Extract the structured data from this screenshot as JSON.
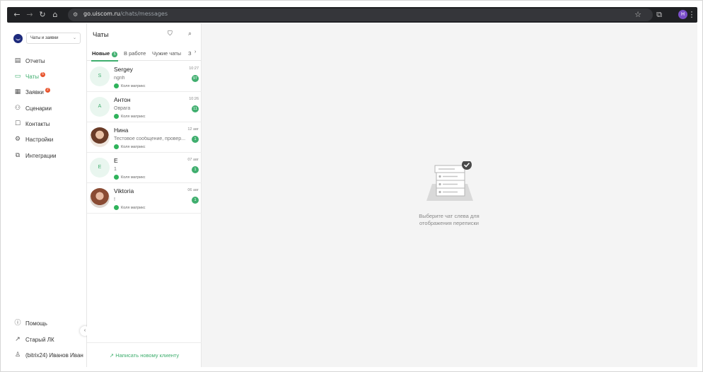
{
  "browser": {
    "url_host": "go.uiscom.ru",
    "url_path": "/chats/messages",
    "profile_initial": "Н"
  },
  "sidebar": {
    "workspace": "Чаты и заявки",
    "items": [
      {
        "label": "Отчеты",
        "icon": "reports-icon",
        "active": false
      },
      {
        "label": "Чаты",
        "icon": "chats-icon",
        "active": true,
        "badge": "5"
      },
      {
        "label": "Заявки",
        "icon": "requests-icon",
        "active": false,
        "badge": "2"
      },
      {
        "label": "Сценарии",
        "icon": "scenarios-icon",
        "active": false
      },
      {
        "label": "Контакты",
        "icon": "contacts-icon",
        "active": false
      },
      {
        "label": "Настройки",
        "icon": "settings-icon",
        "active": false
      },
      {
        "label": "Интеграции",
        "icon": "integrations-icon",
        "active": false
      }
    ],
    "bottom": [
      {
        "label": "Помощь",
        "icon": "help-icon"
      },
      {
        "label": "Старый ЛК",
        "icon": "external-link-icon"
      },
      {
        "label": "(bitrix24) Иванов Иван",
        "icon": "user-icon"
      }
    ]
  },
  "chats": {
    "title": "Чаты",
    "tabs": [
      {
        "label": "Новые",
        "count": "5",
        "active": true
      },
      {
        "label": "В работе",
        "active": false
      },
      {
        "label": "Чужие чаты",
        "active": false
      },
      {
        "label": "З",
        "active": false
      }
    ],
    "list": [
      {
        "name": "Sergey",
        "initial": "S",
        "preview": "ngnh",
        "source": "Коля матрикс",
        "time": "10:27",
        "count": "97",
        "photo": false
      },
      {
        "name": "Антон",
        "initial": "А",
        "preview": "Оврага",
        "source": "Коля матрикс",
        "time": "10:26",
        "count": "11",
        "photo": false
      },
      {
        "name": "Нина",
        "initial": "",
        "preview": "Тестовое сообщение, провер...",
        "source": "Коля матрикс",
        "time": "12 авг",
        "count": "1",
        "photo": true
      },
      {
        "name": "E",
        "initial": "E",
        "preview": "1",
        "source": "Коля матрикс",
        "time": "07 авг",
        "count": "1",
        "photo": false
      },
      {
        "name": "Viktoria",
        "initial": "",
        "preview": "!",
        "source": "Коля матрикс",
        "time": "06 авг",
        "count": "1",
        "photo": true
      }
    ],
    "write_new": "Написать новому клиенту"
  },
  "main": {
    "empty_line1": "Выберите чат слева для",
    "empty_line2": "отображения переписки"
  },
  "colors": {
    "accent": "#3fae6e",
    "badge": "#e8542d"
  }
}
